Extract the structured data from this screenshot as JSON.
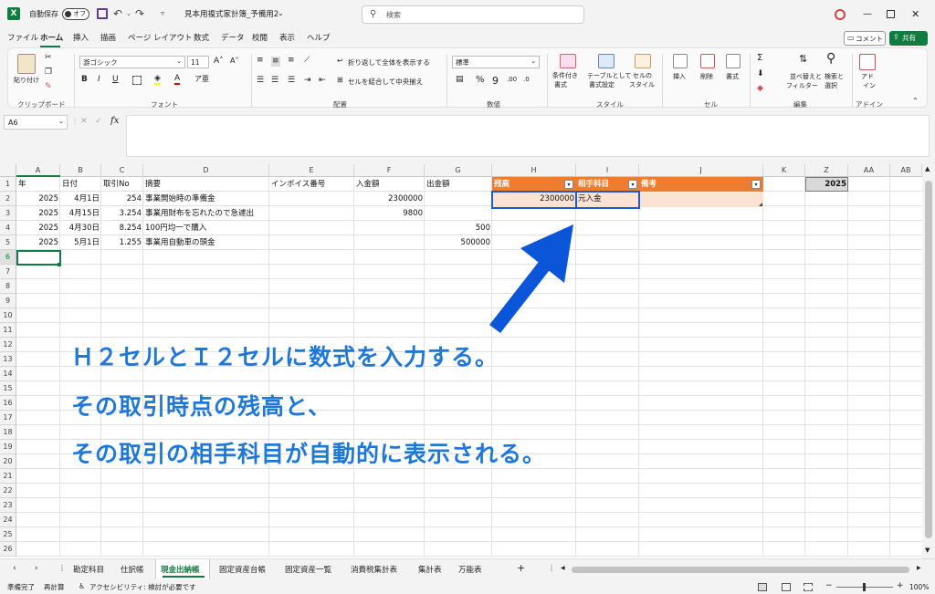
{
  "titlebar": {
    "autosave_label": "自動保存",
    "autosave_state": "オフ",
    "file_title": "見本用複式家計簿_予備用2",
    "search_placeholder": "検索"
  },
  "menu": [
    "ファイル",
    "ホーム",
    "挿入",
    "描画",
    "ページ レイアウト",
    "数式",
    "データ",
    "校閲",
    "表示",
    "ヘルプ"
  ],
  "menu_active": "ホーム",
  "comment_button": "コメント",
  "share_button": "共有",
  "ribbon": {
    "paste": "貼り付け",
    "clipboard": "クリップボード",
    "font_name": "游ゴシック",
    "font_size": "11",
    "font_group": "フォント",
    "wrap_text": "折り返して全体を表示する",
    "merge_center": "セルを結合して中央揃え",
    "alignment_group": "配置",
    "number_format": "標準",
    "number_group": "数値",
    "cond_format": [
      "条件付き",
      "書式"
    ],
    "table_format": [
      "テーブルとして",
      "書式設定"
    ],
    "cell_style": [
      "セルの",
      "スタイル"
    ],
    "style_group": "スタイル",
    "insert": "挿入",
    "delete": "削除",
    "format": "書式",
    "cells_group": "セル",
    "sort_filter": [
      "並べ替えと",
      "フィルター"
    ],
    "find_select": [
      "検索と",
      "選択"
    ],
    "edit_group": "編集",
    "addin": [
      "アド",
      "イン"
    ],
    "addin_group": "アドイン"
  },
  "name_box": "A6",
  "columns": {
    "A": "A",
    "B": "B",
    "C": "C",
    "D": "D",
    "E": "E",
    "F": "F",
    "G": "G",
    "H": "H",
    "I": "I",
    "J": "J",
    "K": "K",
    "Z": "Z",
    "AA": "AA",
    "AB": "AB"
  },
  "headers": {
    "a": "年",
    "b": "日付",
    "c": "取引No",
    "d": "摘要",
    "e": "インボイス番号",
    "f": "入金額",
    "g": "出金額",
    "h": "残高",
    "i": "相手科目",
    "j": "備考",
    "z": "2025"
  },
  "rows": [
    {
      "a": "2025",
      "b": "4月1日",
      "c": "254",
      "d": "事業開始時の準備金",
      "f": "2300000",
      "g": "",
      "h": "2300000",
      "i": "元入金"
    },
    {
      "a": "2025",
      "b": "4月15日",
      "c": "3.254",
      "d": "事業用財布を忘れたので急遽出",
      "f": "9800",
      "g": "",
      "h": "",
      "i": ""
    },
    {
      "a": "2025",
      "b": "4月30日",
      "c": "8.254",
      "d": "100円均一で購入",
      "f": "",
      "g": "500",
      "h": "",
      "i": ""
    },
    {
      "a": "2025",
      "b": "5月1日",
      "c": "1.255",
      "d": "事業用自動車の頭金",
      "f": "",
      "g": "500000",
      "h": "",
      "i": ""
    }
  ],
  "row_numbers": [
    "1",
    "2",
    "3",
    "4",
    "5",
    "6",
    "7",
    "8",
    "9",
    "10",
    "11",
    "12",
    "13",
    "14",
    "15",
    "16",
    "17",
    "18",
    "19",
    "20",
    "21",
    "22",
    "23",
    "24",
    "25",
    "26"
  ],
  "annotation": [
    "Ｈ２セルとＩ２セルに数式を入力する。",
    "その取引時点の残高と、",
    "その取引の相手科目が自動的に表示される。"
  ],
  "sheet_tabs": [
    "勘定科目",
    "仕訳帳",
    "現金出納帳",
    "固定資産台帳",
    "固定資産一覧",
    "消費税集計表",
    "集計表",
    "万能表"
  ],
  "active_sheet": "現金出納帳",
  "status": {
    "ready": "準備完了",
    "recalc": "再計算",
    "accessibility": "アクセシビリティ: 検討が必要です",
    "zoom": "100%"
  },
  "colors": {
    "excel_green": "#107c41",
    "table_header": "#ed7d31",
    "table_row": "#fbe2d5",
    "selection": "#1f5bd0",
    "annotation_text": "#1f78d8",
    "arrow": "#0a55d8"
  }
}
